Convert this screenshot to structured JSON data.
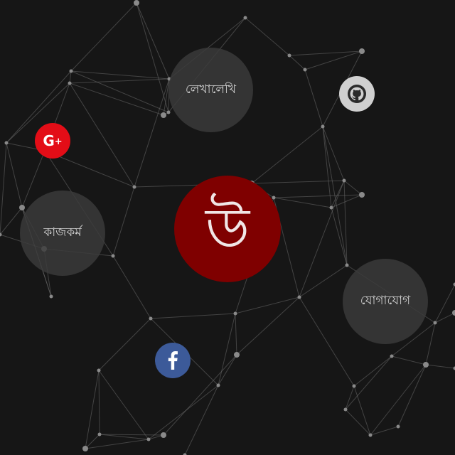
{
  "colors": {
    "background": "#161616",
    "brand_red": "#7f0000",
    "bubble_gray": "#3a3a3a",
    "google_plus_red": "#e30d17",
    "github_gray": "#d0d0d0",
    "facebook_blue": "#3c5a99",
    "network_line": "#6a6a6a",
    "network_node": "#8a8a8a"
  },
  "brand": {
    "letter": "উ"
  },
  "menu": {
    "writing": "লেখালেখি",
    "work": "কাজকর্ম",
    "contact": "যোগাযোগ"
  },
  "social": {
    "google_plus": {
      "icon": "google-plus-icon",
      "label": "G+"
    },
    "github": {
      "icon": "github-icon"
    },
    "facebook": {
      "icon": "facebook-icon"
    }
  }
}
